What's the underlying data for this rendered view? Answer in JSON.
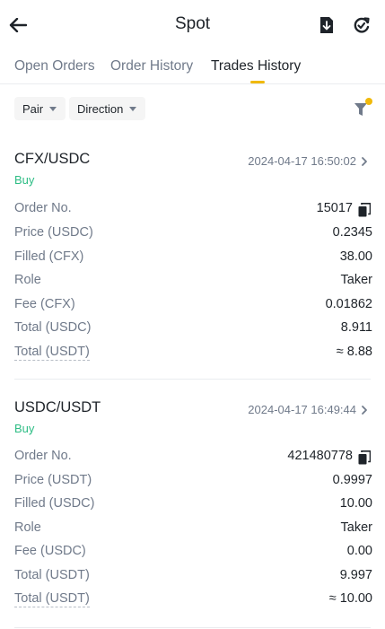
{
  "header": {
    "title": "Spot",
    "back_icon": "arrow-left-icon",
    "export_icon": "download-document-icon",
    "refresh_icon": "refresh-check-icon"
  },
  "tabs": [
    {
      "label": "Open Orders",
      "active": false
    },
    {
      "label": "Order History",
      "active": false
    },
    {
      "label": "Trades History",
      "active": true
    }
  ],
  "filters": {
    "pair_label": "Pair",
    "direction_label": "Direction",
    "filter_icon": "filter-icon"
  },
  "colors": {
    "accent": "#f0b90b",
    "buy": "#2ebd85",
    "muted": "#707a8a",
    "text": "#1e2329"
  },
  "trades": [
    {
      "pair": "CFX/USDC",
      "side": "Buy",
      "time": "2024-04-17 16:50:02",
      "rows": [
        {
          "label": "Order No.",
          "value": "15017"
        },
        {
          "label": "Price (USDC)",
          "value": "0.2345"
        },
        {
          "label": "Filled (CFX)",
          "value": "38.00"
        },
        {
          "label": "Role",
          "value": "Taker"
        },
        {
          "label": "Fee (CFX)",
          "value": "0.01862"
        },
        {
          "label": "Total (USDC)",
          "value": "8.911"
        },
        {
          "label": "Total (USDT)",
          "value": "≈ 8.88"
        }
      ]
    },
    {
      "pair": "USDC/USDT",
      "side": "Buy",
      "time": "2024-04-17 16:49:44",
      "rows": [
        {
          "label": "Order No.",
          "value": "421480778"
        },
        {
          "label": "Price (USDT)",
          "value": "0.9997"
        },
        {
          "label": "Filled (USDC)",
          "value": "10.00"
        },
        {
          "label": "Role",
          "value": "Taker"
        },
        {
          "label": "Fee (USDC)",
          "value": "0.00"
        },
        {
          "label": "Total (USDT)",
          "value": "9.997"
        },
        {
          "label": "Total (USDT)",
          "value": "≈ 10.00"
        }
      ]
    }
  ]
}
